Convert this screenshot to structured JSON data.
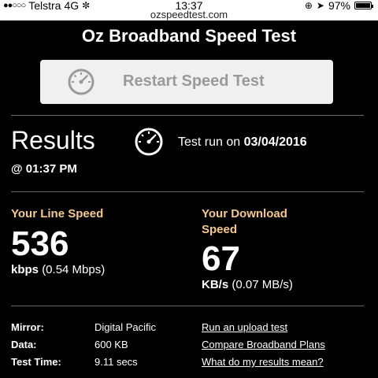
{
  "status_bar": {
    "carrier": "Telstra",
    "network": "4G",
    "time": "13:37",
    "battery": "97%",
    "signal_dots": "●●○○○"
  },
  "url": "ozspeedtest.com",
  "page_title": "Oz Broadband Speed Test",
  "restart_button": {
    "label": "Restart Speed Test",
    "icon": "speedometer-icon"
  },
  "results": {
    "title": "Results",
    "icon": "speedometer-icon",
    "run_prefix": "Test run on",
    "run_date": "03/04/2016",
    "run_time": "@ 01:37 PM"
  },
  "line_speed": {
    "label": "Your Line Speed",
    "value": "536",
    "unit": "kbps",
    "alt": "(0.54 Mbps)"
  },
  "download_speed": {
    "label_line1": "Your Download",
    "label_line2": "Speed",
    "value": "67",
    "unit": "KB/s",
    "alt": "(0.07 MB/s)"
  },
  "info": {
    "mirror_key": "Mirror:",
    "mirror_val": "Digital Pacific",
    "data_key": "Data:",
    "data_val": "600 KB",
    "testtime_key": "Test Time:",
    "testtime_val": "9.11 secs"
  },
  "links": {
    "upload": "Run an upload test",
    "compare": "Compare Broadband Plans",
    "meaning": "What do my results mean?"
  },
  "colors": {
    "accent": "#f5c98a",
    "background": "#000000",
    "button": "#f0f0f0"
  }
}
